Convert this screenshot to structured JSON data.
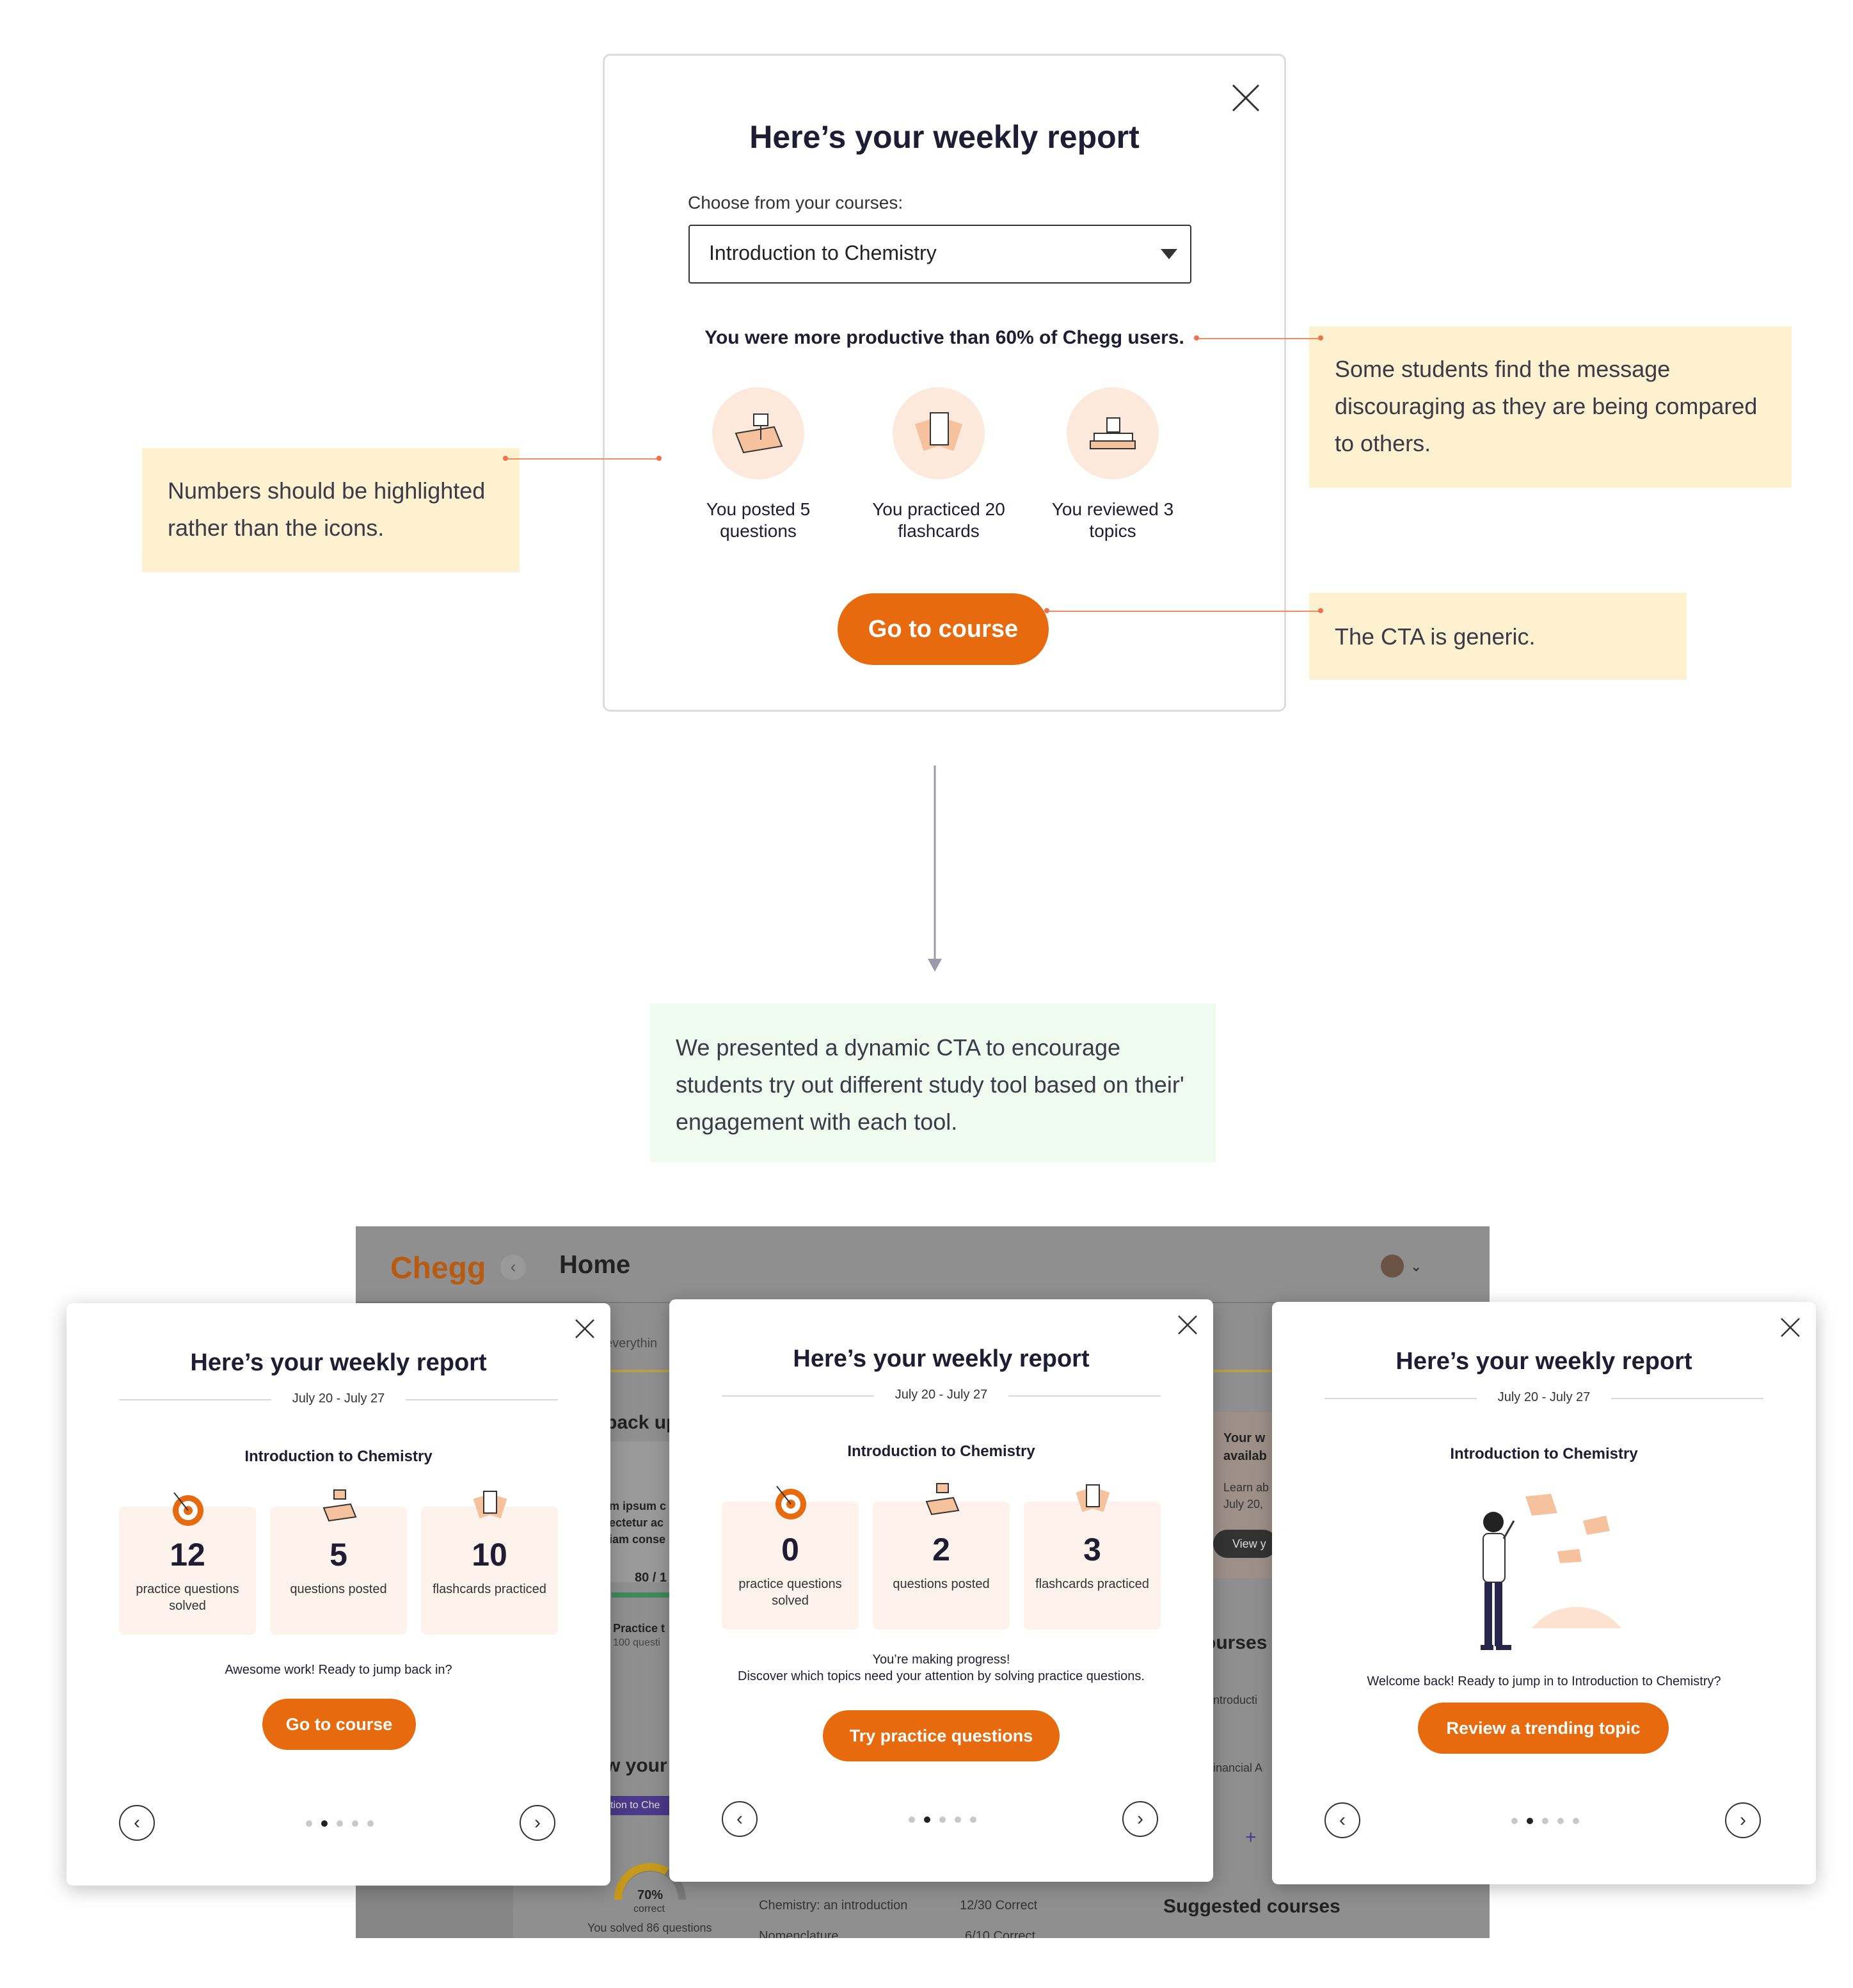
{
  "top_modal": {
    "title": "Here’s your weekly report",
    "course_label": "Choose from your courses:",
    "course_selected": "Introduction to Chemistry",
    "productivity": "You were more productive than 60% of Chegg users.",
    "stats": [
      {
        "icon": "posted-questions-icon",
        "label": "You posted 5 questions"
      },
      {
        "icon": "flashcards-icon",
        "label": "You practiced 20 flashcards"
      },
      {
        "icon": "books-coffee-icon",
        "label": "You reviewed 3 topics"
      }
    ],
    "cta": "Go to course"
  },
  "notes": {
    "numbers": "Numbers should be highlighted rather than the icons.",
    "discouraging": "Some students find the message discouraging as they are being compared to others.",
    "cta_generic": "The CTA is generic.",
    "solution": "We presented a dynamic CTA to encourage students try out different study tool based on their' engagement with each tool."
  },
  "dashboard": {
    "logo": "Chegg",
    "title": "Home",
    "frag_everything": "everythin",
    "frag_back": "back up",
    "frag_lorem": [
      "m ipsum c",
      "ectetur ac",
      "iam conse"
    ],
    "frag_score": "80 / 1",
    "frag_practice": "Practice t",
    "frag_practice_sub": "100 questi",
    "frag_wyour": "w your",
    "frag_tab": "ction to Che",
    "gauge_pct": "70%",
    "gauge_sub": "correct",
    "solved": "You solved 86 questions",
    "row1_name": "Chemistry: an introduction",
    "row1_score": "12/30 Correct",
    "row2_name": "Nomenclature",
    "row2_score": "6/10 Correct",
    "right_your": "Your w",
    "right_avail": "availab",
    "right_learn": "Learn ab",
    "right_date": "July 20,",
    "right_view": "View y",
    "right_courses": "ourses",
    "right_c1": "ntroducti",
    "right_c2": "inancial A",
    "right_plus": "+",
    "suggested": "Suggested courses"
  },
  "modals": [
    {
      "title": "Here’s your weekly report",
      "date": "July 20 - July 27",
      "course": "Introduction to Chemistry",
      "tiles": [
        {
          "num": "12",
          "label": "practice questions solved",
          "icon": "target-icon"
        },
        {
          "num": "5",
          "label": "questions posted",
          "icon": "posted-questions-icon"
        },
        {
          "num": "10",
          "label": "flashcards practiced",
          "icon": "flashcards-icon"
        }
      ],
      "message": "Awesome work! Ready to jump back in?",
      "cta": "Go to course"
    },
    {
      "title": "Here’s your weekly report",
      "date": "July 20 - July 27",
      "course": "Introduction to Chemistry",
      "tiles": [
        {
          "num": "0",
          "label": "practice questions solved",
          "icon": "target-icon"
        },
        {
          "num": "2",
          "label": "questions posted",
          "icon": "posted-questions-icon"
        },
        {
          "num": "3",
          "label": "flashcards practiced",
          "icon": "flashcards-icon"
        }
      ],
      "message1": "You’re making progress!",
      "message2": "Discover which topics need your attention by solving practice questions.",
      "cta": "Try practice questions"
    },
    {
      "title": "Here’s your weekly report",
      "date": "July 20 - July 27",
      "course": "Introduction to Chemistry",
      "illustration": "student-looking-illustration",
      "message": "Welcome back! Ready to jump in to Introduction to Chemistry?",
      "cta": "Review a trending topic"
    }
  ],
  "colors": {
    "accent": "#e86a0f",
    "note": "#fdf1d0",
    "note_green": "#eefbee",
    "connector": "#f08b62"
  }
}
